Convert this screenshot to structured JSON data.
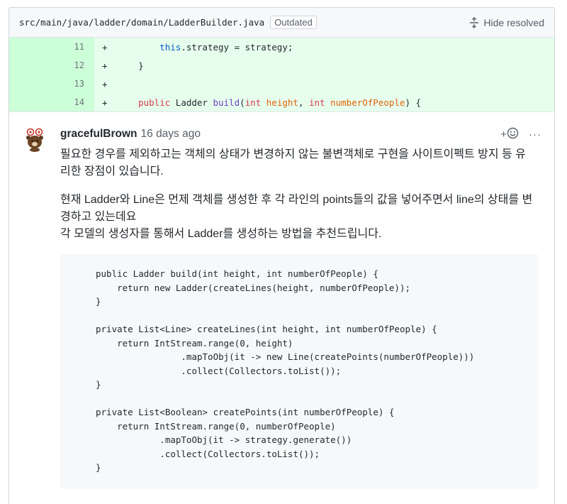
{
  "file_header": {
    "path": "src/main/java/ladder/domain/LadderBuilder.java",
    "badge": "Outdated",
    "hide_resolved": "Hide resolved"
  },
  "diff_lines": [
    {
      "number": "11",
      "marker": "+",
      "code": "        this.strategy = strategy;"
    },
    {
      "number": "12",
      "marker": "+",
      "code": "    }"
    },
    {
      "number": "13",
      "marker": "+",
      "code": ""
    },
    {
      "number": "14",
      "marker": "+",
      "code": "    public Ladder build(int height, int numberOfPeople) {"
    }
  ],
  "comment": {
    "author": "gracefulBrown",
    "timestamp": "16 days ago",
    "reaction_label": "+",
    "more_label": "···",
    "paragraph1": "필요한 경우를 제외하고는 객체의 상태가 변경하지 않는 불변객체로 구현을 사이트이펙트 방지 등 유리한 장점이 있습니다.",
    "paragraph2_line1": "현재 Ladder와 Line은 먼제 객체를 생성한 후 각 라인의 points들의 값을 넣어주면서 line의 상태를 변경하고 있는데요",
    "paragraph2_line2": "각 모델의 생성자를 통해서 Ladder를 생성하는 방법을 추천드립니다.",
    "code_block": "public Ladder build(int height, int numberOfPeople) {\n    return new Ladder(createLines(height, numberOfPeople));\n}\n\nprivate List<Line> createLines(int height, int numberOfPeople) {\n    return IntStream.range(0, height)\n                .mapToObj(it -> new Line(createPoints(numberOfPeople)))\n                .collect(Collectors.toList());\n}\n\nprivate List<Boolean> createPoints(int numberOfPeople) {\n    return IntStream.range(0, numberOfPeople)\n            .mapToObj(it -> strategy.generate())\n            .collect(Collectors.toList());\n}"
  },
  "icons": {
    "hide_resolved": "fold-icon",
    "reaction": "smiley-icon",
    "avatar": "brown-bear-avatar"
  },
  "colors": {
    "diff_added_bg": "#e6ffed",
    "diff_added_num_bg": "#cdffd8",
    "keyword": "#d73a49",
    "function": "#6f42c1",
    "this": "#005cc5",
    "param": "#e36209"
  }
}
